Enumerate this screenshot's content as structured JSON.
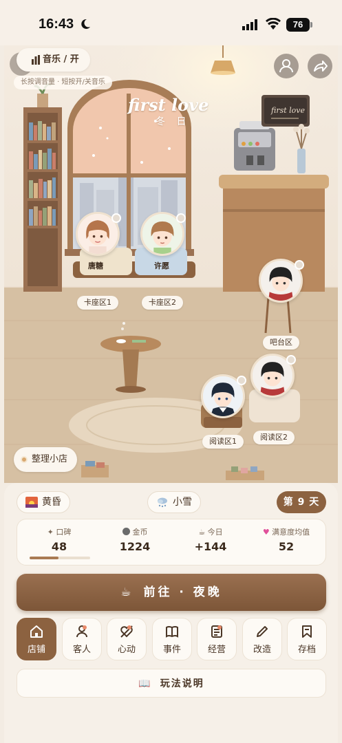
{
  "status_bar": {
    "time": "16:43",
    "battery": "76"
  },
  "top": {
    "music_label": "音乐 / 开",
    "music_hint": "长按调音量 · 短按开/关音乐"
  },
  "scene": {
    "title": "first love",
    "season": "冬 日",
    "sign_text": "first love",
    "characters": [
      {
        "name": "唐糖",
        "zone": "卡座区1"
      },
      {
        "name": "许愿",
        "zone": "卡座区2"
      },
      {
        "zone": "吧台区"
      },
      {
        "zone": "阅读区1"
      },
      {
        "zone": "阅读区2"
      }
    ],
    "tidy_button": "整理小店"
  },
  "panel": {
    "time_of_day": "黄昏",
    "weather": "小雪",
    "day": "第 9 天",
    "stats": [
      {
        "label": "口碑",
        "value": "48",
        "progress": 0.48
      },
      {
        "label": "金币",
        "value": "1224"
      },
      {
        "label": "今日",
        "value": "+144"
      },
      {
        "label": "满意度均值",
        "value": "52"
      }
    ],
    "go_button": "前往 · 夜晚",
    "nav": [
      {
        "label": "店铺",
        "icon": "home-icon",
        "active": true
      },
      {
        "label": "客人",
        "icon": "person-icon"
      },
      {
        "label": "心动",
        "icon": "heart-arrow-icon"
      },
      {
        "label": "事件",
        "icon": "book-icon"
      },
      {
        "label": "经营",
        "icon": "ledger-icon"
      },
      {
        "label": "改造",
        "icon": "pencil-icon"
      },
      {
        "label": "存档",
        "icon": "bookmark-icon"
      }
    ],
    "help_button": "玩法说明"
  },
  "colors": {
    "accent": "#8c6240",
    "panel_bg": "#f6f0e8",
    "card_bg": "#fdfaf5"
  }
}
